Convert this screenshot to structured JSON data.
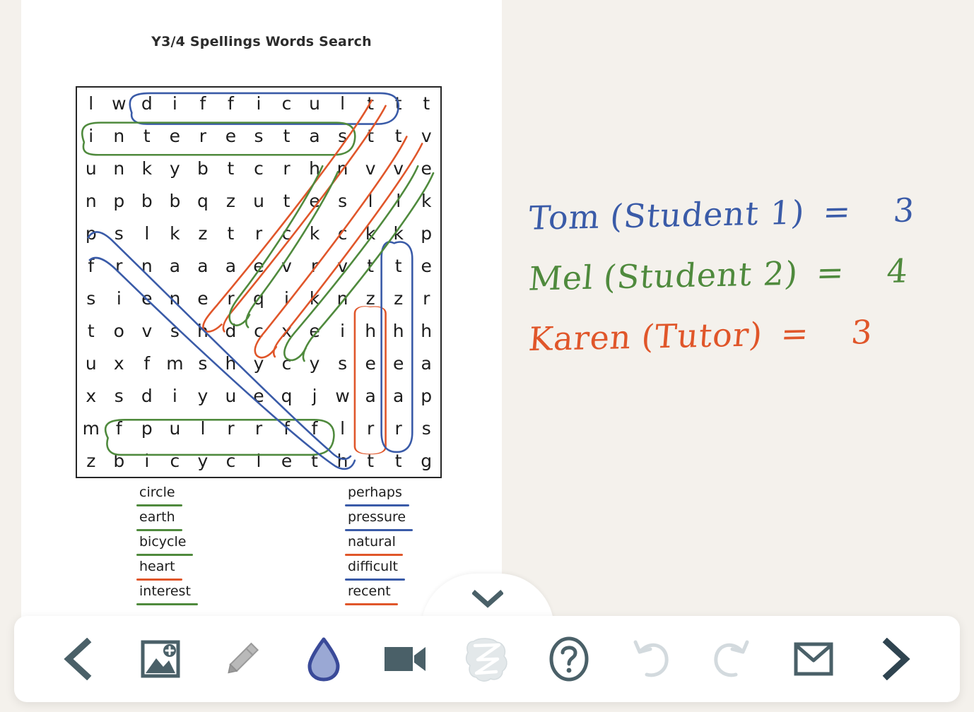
{
  "app": {
    "background_color": "#f4f1ec",
    "sheet_color": "#ffffff"
  },
  "worksheet": {
    "title": "Y3/4 Spellings Words Search",
    "grid": {
      "rows": 12,
      "cols": 13,
      "letters": [
        [
          "l",
          "w",
          "d",
          "i",
          "f",
          "f",
          "i",
          "c",
          "u",
          "l",
          "t",
          "t",
          "t"
        ],
        [
          "i",
          "n",
          "t",
          "e",
          "r",
          "e",
          "s",
          "t",
          "a",
          "s",
          "t",
          "t",
          "v"
        ],
        [
          "u",
          "n",
          "k",
          "y",
          "b",
          "t",
          "c",
          "r",
          "h",
          "n",
          "v",
          "v",
          "e"
        ],
        [
          "n",
          "p",
          "b",
          "b",
          "q",
          "z",
          "u",
          "t",
          "e",
          "s",
          "l",
          "l",
          "k"
        ],
        [
          "p",
          "s",
          "l",
          "k",
          "z",
          "t",
          "r",
          "c",
          "k",
          "c",
          "k",
          "k",
          "p"
        ],
        [
          "f",
          "r",
          "n",
          "a",
          "a",
          "a",
          "e",
          "v",
          "r",
          "v",
          "t",
          "t",
          "e"
        ],
        [
          "s",
          "i",
          "e",
          "n",
          "e",
          "r",
          "q",
          "i",
          "k",
          "n",
          "z",
          "z",
          "r"
        ],
        [
          "t",
          "o",
          "v",
          "s",
          "h",
          "d",
          "c",
          "x",
          "e",
          "i",
          "h",
          "h",
          "h"
        ],
        [
          "u",
          "x",
          "f",
          "m",
          "s",
          "h",
          "y",
          "c",
          "y",
          "s",
          "e",
          "e",
          "a"
        ],
        [
          "x",
          "s",
          "d",
          "i",
          "y",
          "u",
          "e",
          "q",
          "j",
          "w",
          "a",
          "a",
          "p"
        ],
        [
          "m",
          "f",
          "p",
          "u",
          "l",
          "r",
          "r",
          "f",
          "f",
          "l",
          "r",
          "r",
          "s"
        ],
        [
          "z",
          "b",
          "i",
          "c",
          "y",
          "c",
          "l",
          "e",
          "t",
          "h",
          "t",
          "t",
          "g"
        ]
      ]
    },
    "word_list": {
      "left_column": [
        {
          "word": "circle",
          "underline_color": "#4f8a3d"
        },
        {
          "word": "earth",
          "underline_color": "#4f8a3d"
        },
        {
          "word": "bicycle",
          "underline_color": "#4f8a3d"
        },
        {
          "word": "heart",
          "underline_color": "#e0562a"
        },
        {
          "word": "interest",
          "underline_color": "#4f8a3d"
        }
      ],
      "right_column": [
        {
          "word": "perhaps",
          "underline_color": "#3a5ba8"
        },
        {
          "word": "pressure",
          "underline_color": "#3a5ba8"
        },
        {
          "word": "natural",
          "underline_color": "#e0562a"
        },
        {
          "word": "difficult",
          "underline_color": "#3a5ba8"
        },
        {
          "word": "recent",
          "underline_color": "#e0562a"
        }
      ]
    }
  },
  "annotations": {
    "ink_colors": {
      "blue": "#3a5ba8",
      "green": "#4f8a3d",
      "orange": "#e0562a"
    },
    "notes": [
      {
        "name": "Tom",
        "role": "(Student 1)",
        "equals": "=",
        "score": "3",
        "color": "#3a5ba8"
      },
      {
        "name": "Mel",
        "role": "(Student 2)",
        "equals": "=",
        "score": "4",
        "color": "#4f8a3d"
      },
      {
        "name": "Karen",
        "role": "(Tutor)",
        "equals": "=",
        "score": "3",
        "color": "#e0562a"
      }
    ]
  },
  "toolbar": {
    "collapse_tab": {
      "icon": "chevron-down-icon"
    },
    "icon_color": "#4a6068",
    "icon_color_disabled": "#d3dade",
    "buttons": [
      {
        "id": "back",
        "icon": "chevron-left-icon",
        "label": "Previous"
      },
      {
        "id": "add-image",
        "icon": "image-add-icon",
        "label": "Add image"
      },
      {
        "id": "pencil",
        "icon": "pencil-icon",
        "label": "Pencil"
      },
      {
        "id": "ink",
        "icon": "ink-drop-icon",
        "label": "Ink colour"
      },
      {
        "id": "video",
        "icon": "video-camera-icon",
        "label": "Record video"
      },
      {
        "id": "eraser",
        "icon": "eraser-icon",
        "label": "Eraser"
      },
      {
        "id": "help",
        "icon": "question-mark-icon",
        "label": "Help"
      },
      {
        "id": "undo",
        "icon": "undo-icon",
        "label": "Undo"
      },
      {
        "id": "redo",
        "icon": "redo-icon",
        "label": "Redo"
      },
      {
        "id": "mail",
        "icon": "envelope-icon",
        "label": "Send"
      },
      {
        "id": "forward",
        "icon": "chevron-right-icon",
        "label": "Next"
      }
    ]
  }
}
